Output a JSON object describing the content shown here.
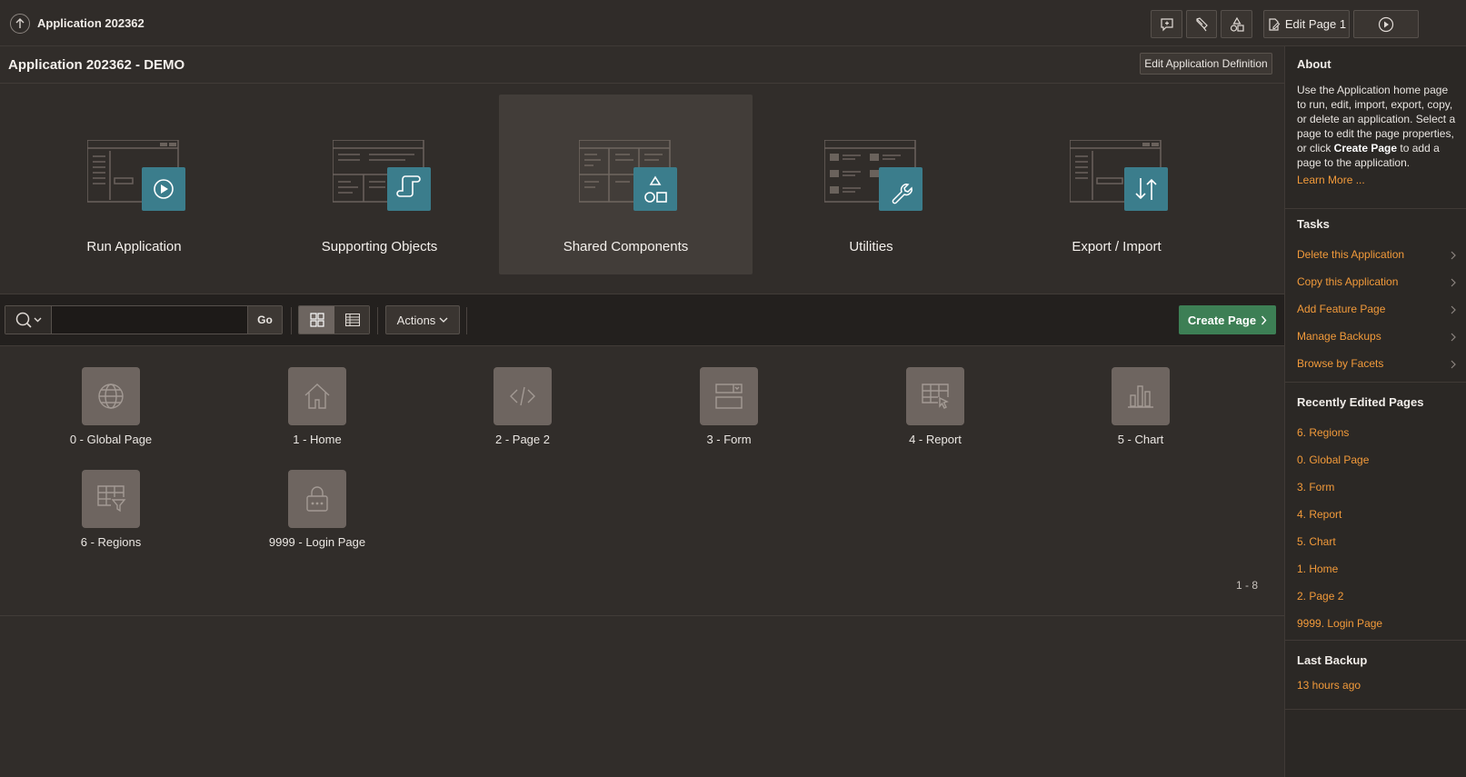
{
  "header": {
    "app_name": "Application 202362",
    "edit_page_label": "Edit Page 1"
  },
  "app": {
    "title": "Application 202362 - DEMO",
    "edit_definition_label": "Edit Application Definition"
  },
  "cards": [
    {
      "label": "Run Application",
      "icon": "play-icon"
    },
    {
      "label": "Supporting Objects",
      "icon": "scroll-icon"
    },
    {
      "label": "Shared Components",
      "icon": "shapes-icon"
    },
    {
      "label": "Utilities",
      "icon": "wrench-icon"
    },
    {
      "label": "Export / Import",
      "icon": "arrows-up-down-icon"
    }
  ],
  "toolbar": {
    "search_value": "",
    "go_label": "Go",
    "actions_label": "Actions",
    "create_page_label": "Create Page"
  },
  "pages": [
    {
      "label": "0 - Global Page",
      "icon": "globe-icon"
    },
    {
      "label": "1 - Home",
      "icon": "home-icon"
    },
    {
      "label": "2 - Page 2",
      "icon": "code-icon"
    },
    {
      "label": "3 - Form",
      "icon": "form-icon"
    },
    {
      "label": "4 - Report",
      "icon": "report-icon"
    },
    {
      "label": "5 - Chart",
      "icon": "chart-icon"
    },
    {
      "label": "6 - Regions",
      "icon": "table-filter-icon"
    },
    {
      "label": "9999 - Login Page",
      "icon": "lock-icon"
    }
  ],
  "pagination": "1 - 8",
  "sidebar": {
    "about": {
      "heading": "About",
      "text_1": "Use the Application home page to run, edit, import, export, copy, or delete an application. Select a page to edit the page properties, or click ",
      "text_bold": "Create Page",
      "text_2": " to add a page to the application.",
      "learn_more": "Learn More ..."
    },
    "tasks": {
      "heading": "Tasks",
      "items": [
        "Delete this Application",
        "Copy this Application",
        "Add Feature Page",
        "Manage Backups",
        "Browse by Facets"
      ]
    },
    "recent": {
      "heading": "Recently Edited Pages",
      "items": [
        "6. Regions",
        "0. Global Page",
        "3. Form",
        "4. Report",
        "5. Chart",
        "1. Home",
        "2. Page 2",
        "9999. Login Page"
      ]
    },
    "backup": {
      "heading": "Last Backup",
      "value": "13 hours ago"
    }
  },
  "colors": {
    "accent_link": "#f29a3a",
    "create_button": "#3d7f55",
    "card_badge": "#3b7d8c",
    "page_tile": "#6e6560"
  }
}
